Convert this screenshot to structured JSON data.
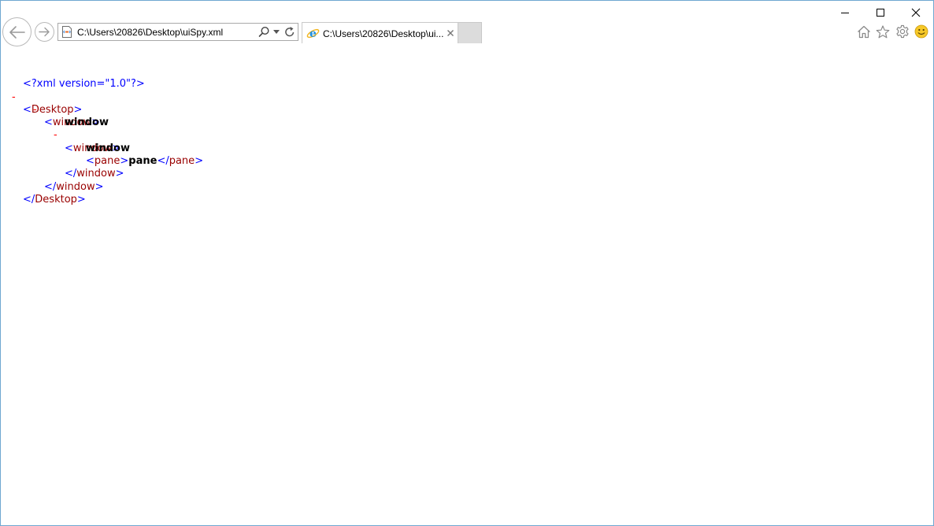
{
  "window_controls": {
    "minimize": "minimize-icon",
    "maximize": "maximize-icon",
    "close": "close-icon"
  },
  "navigation": {
    "back": "back-arrow-icon",
    "forward": "forward-arrow-icon"
  },
  "address_bar": {
    "value": "C:\\Users\\20826\\Desktop\\uiSpy.xml",
    "page_icon": "xml-file-icon",
    "search_icon": "search-icon",
    "dropdown_icon": "chevron-down-icon",
    "refresh_icon": "refresh-icon"
  },
  "tab": {
    "title": "C:\\Users\\20826\\Desktop\\ui...",
    "icon": "ie-logo-icon",
    "close_glyph": "×"
  },
  "toolbar": {
    "home": "home-icon",
    "favorites": "star-icon",
    "settings": "gear-icon",
    "feedback": "smiley-icon"
  },
  "colors": {
    "window_border": "#6fa7d1",
    "xml_tag": "#990000",
    "xml_bracket": "#0000ff",
    "xml_collapse": "#ff0000",
    "text": "#000000"
  },
  "xml": {
    "declaration": "<?xml version=\"1.0\"?>",
    "collapse_glyph": "-",
    "lt": "<",
    "gt": ">",
    "lt_close": "</",
    "desktop_tag": "Desktop",
    "window_tag": "window",
    "pane_tag": "pane",
    "outer_window_text": "window",
    "inner_window_text": "window",
    "pane_text": "pane"
  }
}
